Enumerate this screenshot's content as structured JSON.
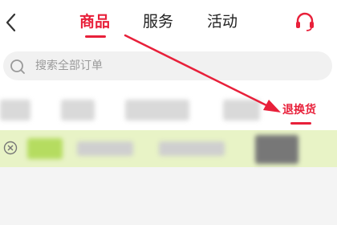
{
  "header": {
    "tabs": [
      {
        "label": "商品",
        "active": true
      },
      {
        "label": "服务",
        "active": false
      },
      {
        "label": "活动",
        "active": false
      }
    ],
    "icons": {
      "back": "chevron-left-icon",
      "support": "headset-icon"
    }
  },
  "search": {
    "placeholder": "搜索全部订单",
    "icon": "search-icon"
  },
  "filters": {
    "active_label": "退换货"
  },
  "order_row": {
    "icon": "close-circle-icon"
  },
  "colors": {
    "accent": "#e8203a",
    "row_highlight": "#e8f3c6",
    "page_bg": "#f4f4f4"
  }
}
